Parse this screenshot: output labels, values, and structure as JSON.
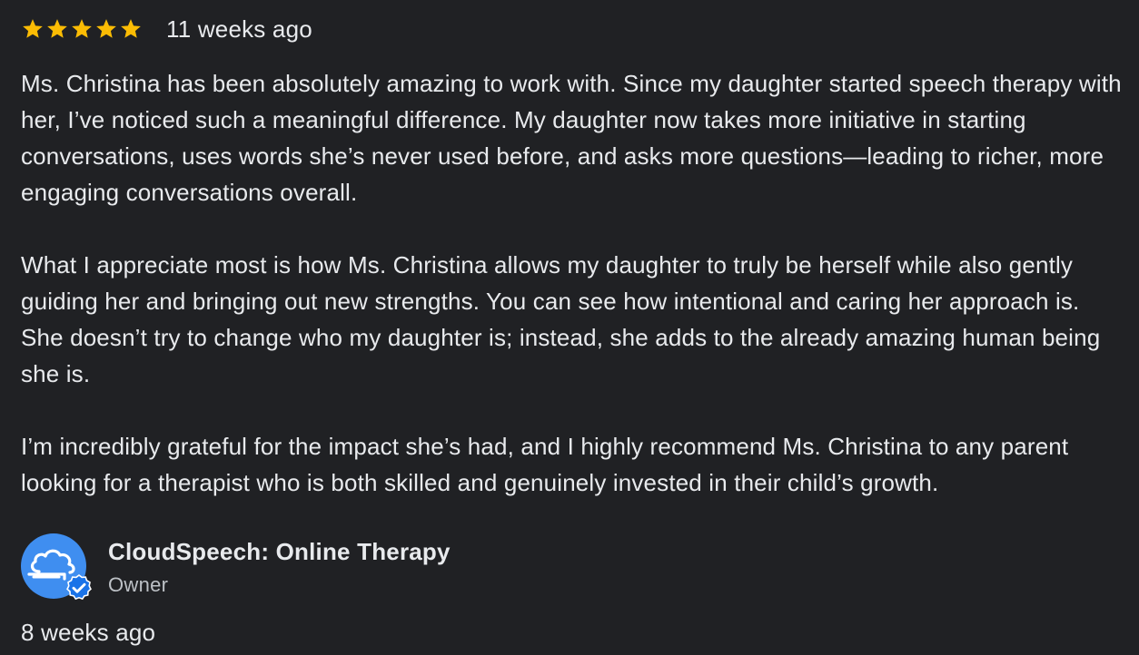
{
  "review": {
    "rating": 5,
    "max_rating": 5,
    "star_color": "#fbbc04",
    "time": "11 weeks ago",
    "paragraphs": [
      "Ms. Christina has been absolutely amazing to work with. Since my daughter started speech therapy with her, I’ve noticed such a meaningful difference. My daughter now takes more initiative in starting conversations, uses words she’s never used before, and asks more questions—leading to richer, more engaging conversations overall.",
      "What I appreciate most is how Ms. Christina allows my daughter to truly be herself while also gently guiding her and bringing out new strengths. You can see how intentional and caring her approach is. She doesn’t try to change who my daughter is; instead, she adds to the already amazing human being she is.",
      "I’m incredibly grateful for the impact she’s had, and I highly recommend Ms. Christina to any parent looking for a therapist who is both skilled and genuinely invested in their child’s growth."
    ]
  },
  "owner_response": {
    "avatar_icon": "cloud-icon",
    "badge_icon": "verified-badge-icon",
    "name": "CloudSpeech: Online Therapy",
    "role": "Owner",
    "time": "8 weeks ago"
  }
}
